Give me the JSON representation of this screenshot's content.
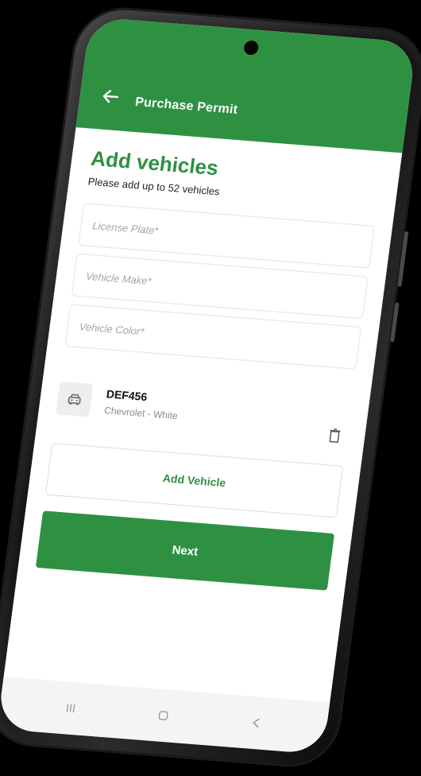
{
  "header": {
    "title": "Purchase Permit"
  },
  "main": {
    "heading": "Add vehicles",
    "subtitle": "Please add up to 52 vehicles"
  },
  "form": {
    "license_plate_placeholder": "License Plate*",
    "vehicle_make_placeholder": "Vehicle Make*",
    "vehicle_color_placeholder": "Vehicle Color*"
  },
  "vehicles": [
    {
      "plate": "DEF456",
      "description": "Chevrolet - White"
    }
  ],
  "buttons": {
    "add_vehicle": "Add Vehicle",
    "next": "Next"
  },
  "icons": {
    "back": "arrow-left-icon",
    "car": "car-icon",
    "trash": "trash-icon",
    "nav_recents": "recents-icon",
    "nav_home": "home-icon",
    "nav_back": "back-chevron-icon"
  },
  "colors": {
    "brand_green": "#2e9142",
    "background": "#ffffff"
  }
}
